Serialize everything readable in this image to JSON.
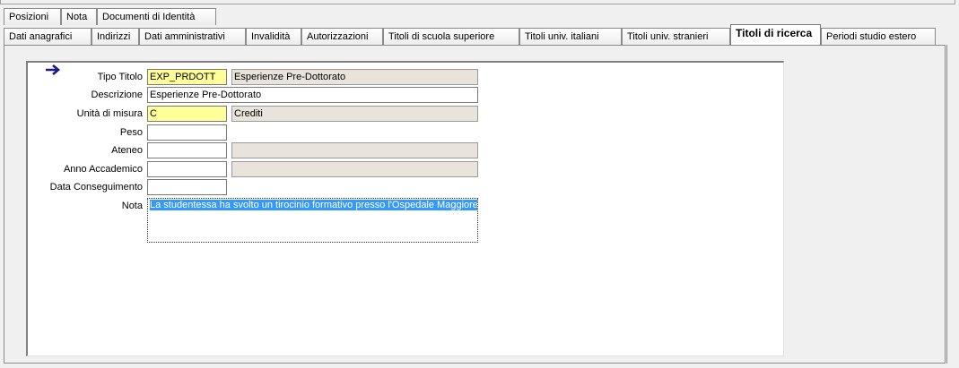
{
  "tabs_row1": [
    "Posizioni",
    "Nota",
    "Documenti di Identità"
  ],
  "tabs_row2": [
    "Dati anagrafici",
    "Indirizzi",
    "Dati amministrativi",
    "Invalidità",
    "Autorizzazioni",
    "Titoli di scuola superiore",
    "Titoli univ. italiani",
    "Titoli univ. stranieri",
    "Titoli di ricerca",
    "Periodi studio estero"
  ],
  "active_tab": "Titoli di ricerca",
  "form": {
    "tipo_titolo": {
      "label": "Tipo Titolo",
      "code": "EXP_PRDOTT",
      "desc": "Esperienze Pre-Dottorato"
    },
    "descrizione": {
      "label": "Descrizione",
      "value": "Esperienze Pre-Dottorato"
    },
    "unita_misura": {
      "label": "Unità di misura",
      "code": "C",
      "desc": "Crediti"
    },
    "peso": {
      "label": "Peso",
      "value": ""
    },
    "ateneo": {
      "label": "Ateneo",
      "code": "",
      "desc": ""
    },
    "anno_accademico": {
      "label": "Anno Accademico",
      "code": "",
      "desc": ""
    },
    "data_conseguimento": {
      "label": "Data Conseguimento",
      "value": ""
    },
    "nota": {
      "label": "Nota",
      "value": "La studentessa ha svolto un tirocinio formativo presso l'Ospedale Maggiore,"
    }
  },
  "colors": {
    "required_field": "#ffff99",
    "readonly_field": "#e8e4dc",
    "selection": "#3399ff",
    "arrow": "#1a1a8c"
  },
  "icons": {
    "current_record": "arrow-right-icon"
  }
}
